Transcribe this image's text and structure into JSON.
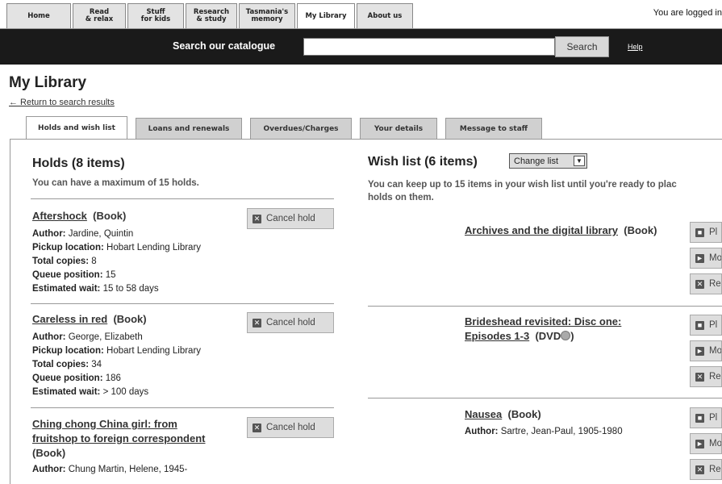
{
  "nav": {
    "tabs": [
      {
        "l1": "Home",
        "l2": ""
      },
      {
        "l1": "Read",
        "l2": "& relax"
      },
      {
        "l1": "Stuff",
        "l2": "for kids"
      },
      {
        "l1": "Research",
        "l2": "& study"
      },
      {
        "l1": "Tasmania's",
        "l2": "memory"
      },
      {
        "l1": "My Library",
        "l2": ""
      },
      {
        "l1": "About us",
        "l2": ""
      }
    ],
    "logged_in": "You are logged in"
  },
  "search": {
    "label": "Search our catalogue",
    "value": "",
    "button": "Search",
    "help": "Help"
  },
  "page": {
    "title": "My Library",
    "back_link": "← Return to search results"
  },
  "tabs": [
    "Holds and wish list",
    "Loans and renewals",
    "Overdues/Charges",
    "Your details",
    "Message to staff"
  ],
  "holds": {
    "heading": "Holds (8 items)",
    "sub": "You can have a maximum of 15 holds.",
    "cancel_label": "Cancel hold",
    "items": [
      {
        "title": "Aftershock",
        "type": "(Book)",
        "author_label": "Author:",
        "author": "Jardine, Quintin",
        "pickup_label": "Pickup location:",
        "pickup": "Hobart Lending Library",
        "copies_label": "Total copies:",
        "copies": "8",
        "queue_label": "Queue position:",
        "queue": "15",
        "wait_label": "Estimated wait:",
        "wait": "15 to 58 days"
      },
      {
        "title": "Careless in red",
        "type": "(Book)",
        "author_label": "Author:",
        "author": "George, Elizabeth",
        "pickup_label": "Pickup location:",
        "pickup": "Hobart Lending Library",
        "copies_label": "Total copies:",
        "copies": "34",
        "queue_label": "Queue position:",
        "queue": "186",
        "wait_label": "Estimated wait:",
        "wait": "> 100 days"
      },
      {
        "title_l1": "Ching chong China girl: from",
        "title_l2": "fruitshop to foreign correspondent",
        "type": "(Book)",
        "author_label": "Author:",
        "author": "Chung Martin, Helene, 1945-"
      }
    ]
  },
  "wishlist": {
    "heading": "Wish list (6 items)",
    "change_list": "Change list",
    "sub_l1": "You can keep up to 15 items in your wish list until you're ready to plac",
    "sub_l2": "holds on them.",
    "btn_place": "Pl",
    "btn_move": "Mo",
    "btn_remove": "Re",
    "items": [
      {
        "title": "Archives and the digital library",
        "type": "(Book)"
      },
      {
        "title_l1": "Brideshead revisited: Disc one:",
        "title_l2": "Episodes 1-3",
        "type": "(DVD",
        "type_end": ")"
      },
      {
        "title": "Nausea",
        "type": "(Book)",
        "author_label": "Author:",
        "author": "Sartre, Jean-Paul, 1905-1980"
      }
    ]
  }
}
